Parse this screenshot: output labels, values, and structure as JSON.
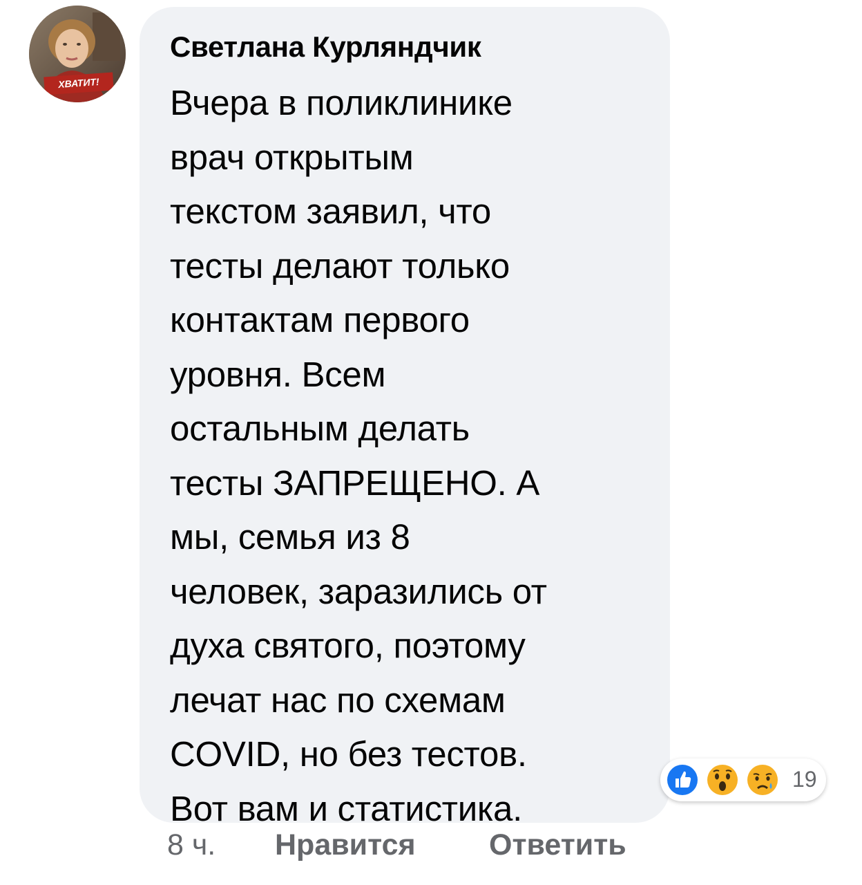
{
  "comment": {
    "author": "Светлана Курляндчик",
    "text_lines": [
      "Вчера в поликлинике",
      "врач открытым",
      "текстом заявил, что",
      "тесты делают только",
      "контактам первого",
      "уровня. Всем",
      "остальным делать",
      "тесты ЗАПРЕЩЕНО. А",
      "мы, семья из 8",
      "человек, заразились от",
      "духа святого, поэтому",
      "лечат нас по схемам",
      "COVID, но без тестов.",
      "Вот вам и статистика."
    ],
    "avatar_badge": "ХВАТИТ!"
  },
  "reactions": {
    "icons": [
      "like-icon",
      "wow-icon",
      "sad-icon"
    ],
    "count": "19",
    "colors": {
      "like": "#1877f2",
      "emoji": "#f7b125"
    }
  },
  "actions": {
    "time": "8 ч.",
    "like": "Нравится",
    "reply": "Ответить"
  },
  "colors": {
    "bubble": "#f0f2f5",
    "text": "#050505",
    "secondary": "#65676b"
  }
}
